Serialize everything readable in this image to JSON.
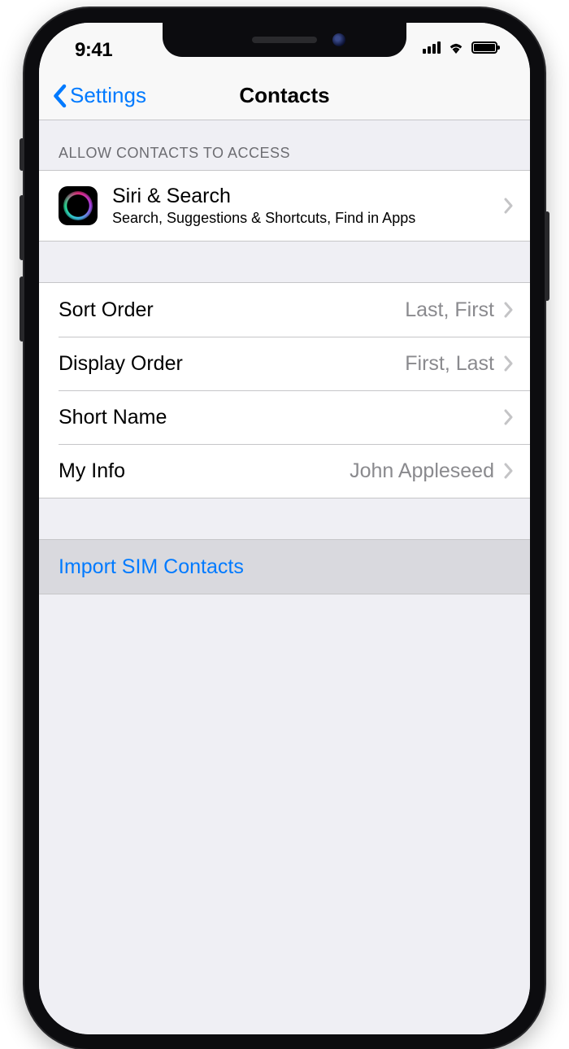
{
  "status": {
    "time": "9:41"
  },
  "nav": {
    "back_label": "Settings",
    "title": "Contacts"
  },
  "groups": {
    "access": {
      "header": "Allow Contacts to Access",
      "siri": {
        "title": "Siri & Search",
        "subtitle": "Search, Suggestions & Shortcuts, Find in Apps"
      }
    },
    "options": {
      "sort_order": {
        "label": "Sort Order",
        "value": "Last, First"
      },
      "display_order": {
        "label": "Display Order",
        "value": "First, Last"
      },
      "short_name": {
        "label": "Short Name",
        "value": ""
      },
      "my_info": {
        "label": "My Info",
        "value": "John Appleseed"
      }
    },
    "import": {
      "label": "Import SIM Contacts"
    }
  }
}
